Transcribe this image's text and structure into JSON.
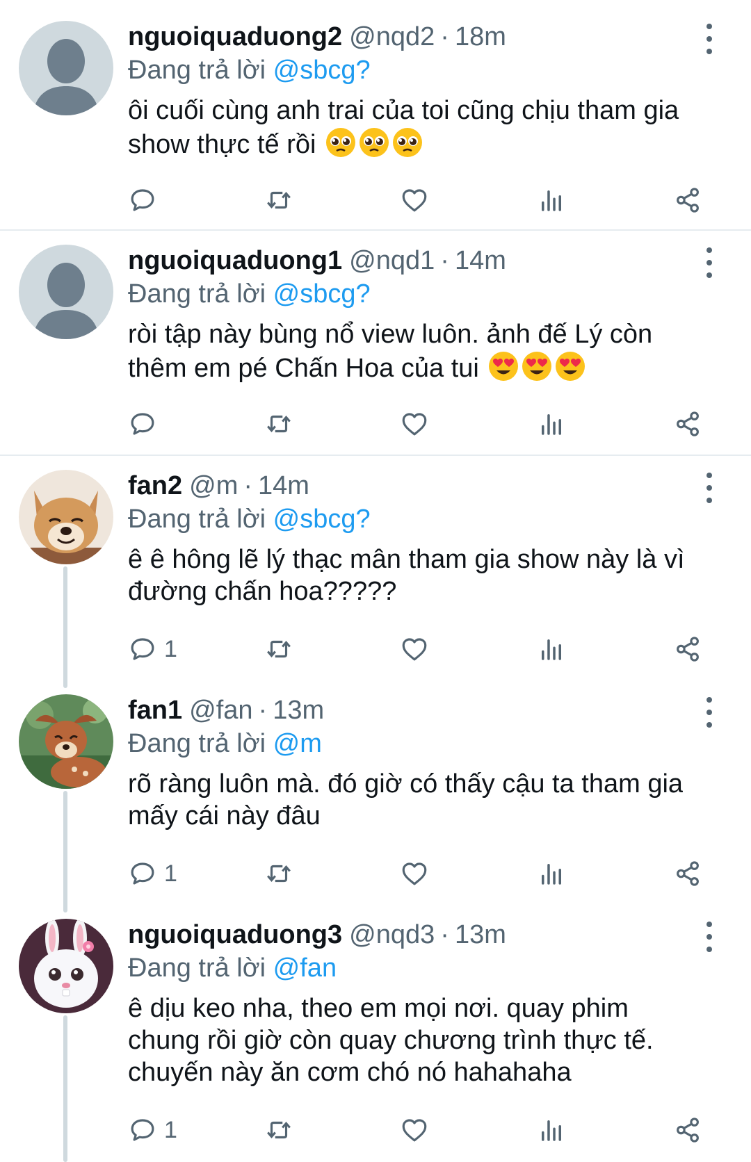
{
  "labels": {
    "replying_to": "Đang trả lời"
  },
  "colors": {
    "mention": "#1d9bf0",
    "muted": "#536471",
    "text": "#0f1419"
  },
  "tweets": [
    {
      "name": "nguoiquaduong2",
      "handle": "@nqd2",
      "time": "18m",
      "reply_to": "@sbcg?",
      "lines": [
        "ôi cuối cùng anh trai của toi cũng chịu tham gia",
        "show thực tế rồi"
      ],
      "emoji": "pleading-face",
      "emoji_count": 3,
      "replies": ""
    },
    {
      "name": "nguoiquaduong1",
      "handle": "@nqd1",
      "time": "14m",
      "reply_to": "@sbcg?",
      "lines": [
        "ròi tập này bùng nổ view luôn. ảnh đế Lý còn",
        "thêm em pé Chấn Hoa của tui"
      ],
      "emoji": "heart-eyes-face",
      "emoji_count": 3,
      "replies": ""
    },
    {
      "name": "fan2",
      "handle": "@m",
      "time": "14m",
      "reply_to": "@sbcg?",
      "lines": [
        "ê ê hông lẽ lý thạc mân tham gia show này là vì",
        "đường chấn hoa?????"
      ],
      "replies": "1"
    },
    {
      "name": "fan1",
      "handle": "@fan",
      "time": "13m",
      "reply_to": "@m",
      "lines": [
        "rõ ràng luôn mà. đó giờ có thấy cậu ta tham gia",
        "mấy cái này đâu"
      ],
      "replies": "1"
    },
    {
      "name": "nguoiquaduong3",
      "handle": "@nqd3",
      "time": "13m",
      "reply_to": "@fan",
      "lines": [
        "ê dịu keo nha, theo em mọi nơi. quay phim",
        "chung rồi giờ còn quay chương trình thực tế.",
        "chuyến này ăn cơm chó nó hahahaha"
      ],
      "replies": "1"
    }
  ]
}
